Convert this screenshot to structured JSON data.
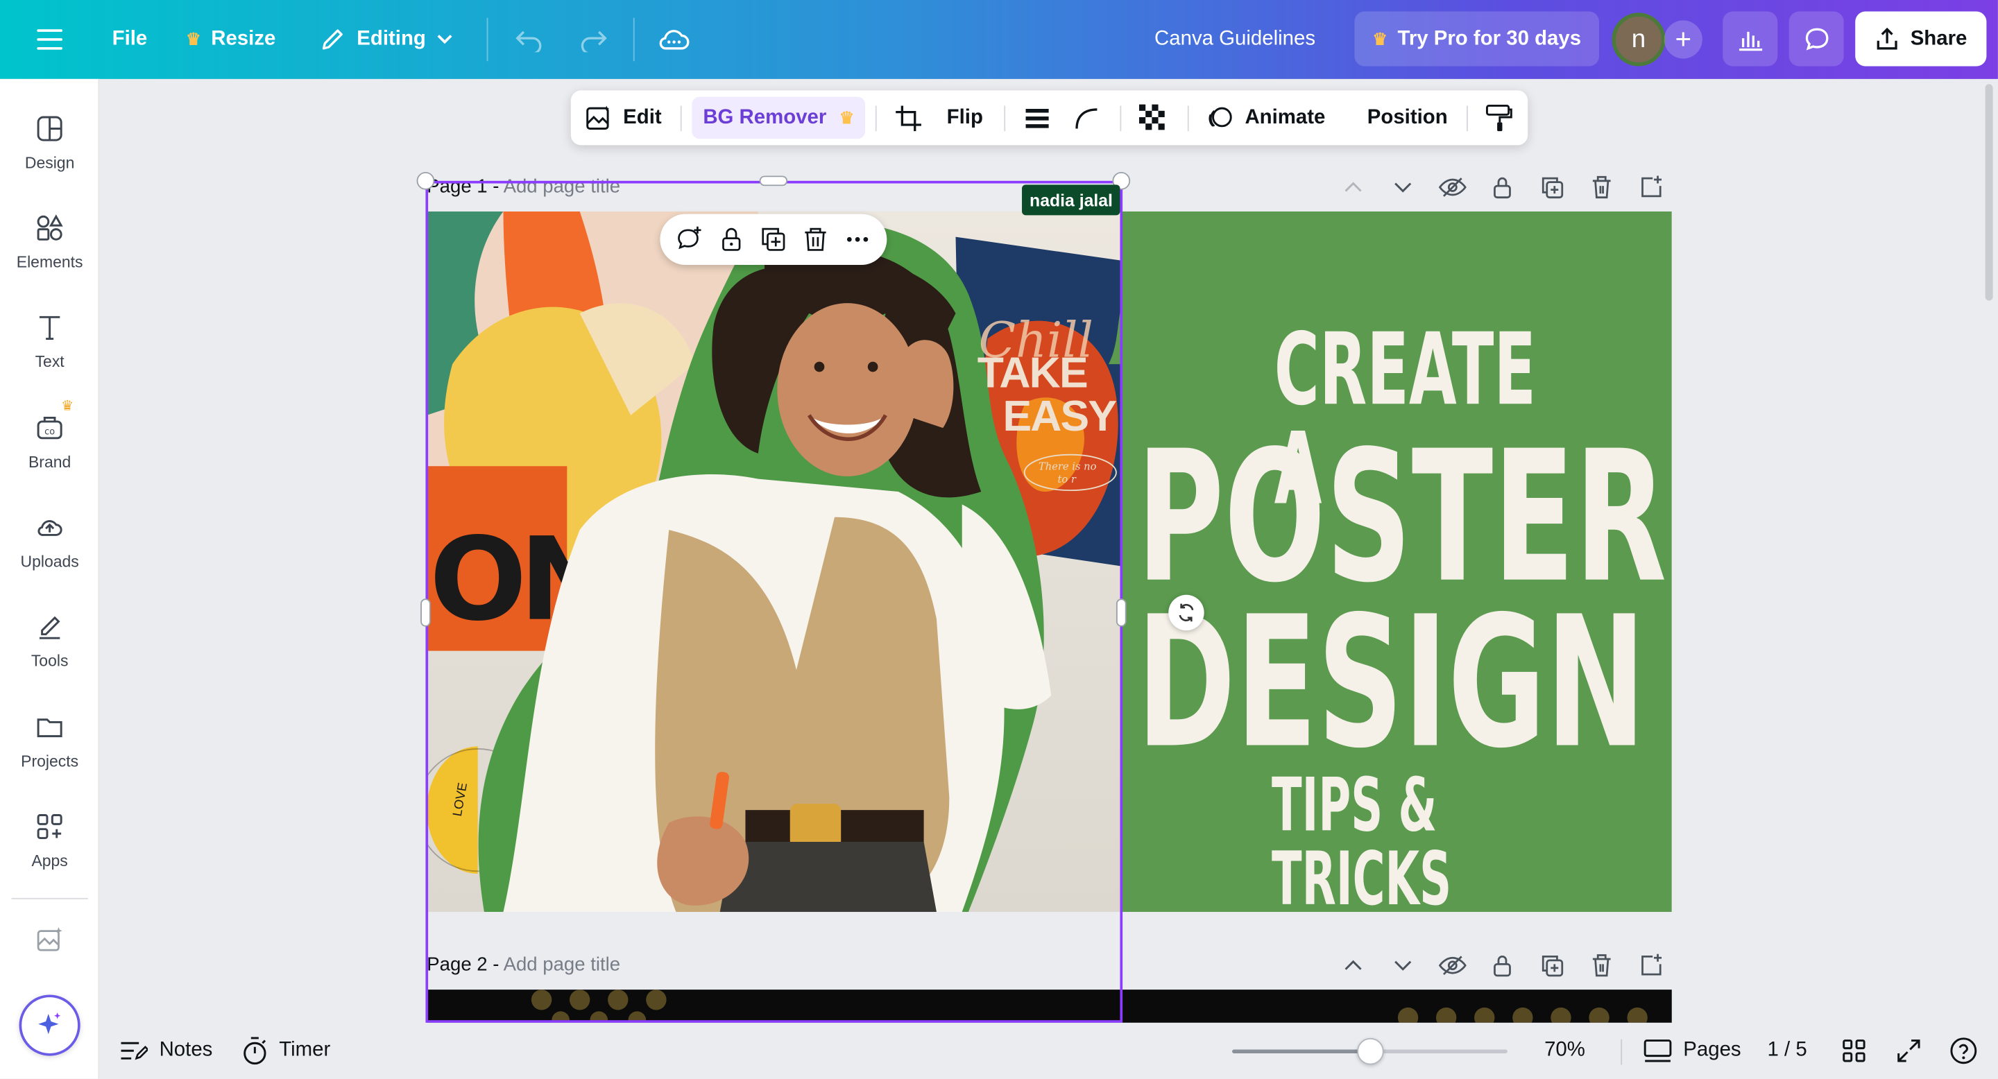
{
  "topbar": {
    "file": "File",
    "resize": "Resize",
    "editing": "Editing",
    "doc_title": "Canva Guidelines",
    "try_pro": "Try Pro for 30 days",
    "avatar_letter": "n",
    "share": "Share"
  },
  "sidebar": {
    "items": [
      {
        "label": "Design",
        "icon": "design-icon"
      },
      {
        "label": "Elements",
        "icon": "elements-icon"
      },
      {
        "label": "Text",
        "icon": "text-icon"
      },
      {
        "label": "Brand",
        "icon": "brand-icon"
      },
      {
        "label": "Uploads",
        "icon": "uploads-icon"
      },
      {
        "label": "Tools",
        "icon": "tools-icon"
      },
      {
        "label": "Projects",
        "icon": "projects-icon"
      },
      {
        "label": "Apps",
        "icon": "apps-icon"
      }
    ]
  },
  "context_toolbar": {
    "edit": "Edit",
    "bg_remover": "BG Remover",
    "flip": "Flip",
    "animate": "Animate",
    "position": "Position"
  },
  "pages": [
    {
      "prefix": "Page 1 - ",
      "placeholder": "Add page title"
    },
    {
      "prefix": "Page 2 - ",
      "placeholder": "Add page title"
    }
  ],
  "collaborator_tag": "nadia jalal",
  "poster": {
    "line1": "CREATE A",
    "line2": "POSTER",
    "line3": "DESIGN",
    "line4": "TIPS & TRICKS",
    "bg_poster_line1": "Chill",
    "bg_poster_line2": "TAKE",
    "bg_poster_line3": "EASY",
    "bg_poster_small": "There is no",
    "bg_poster_small2": "to r",
    "bg_left_text": "ONS",
    "badge_text": "LOVE"
  },
  "bottombar": {
    "notes": "Notes",
    "timer": "Timer",
    "zoom": "70%",
    "zoom_fraction": 0.5,
    "pages": "Pages",
    "page_count": "1 / 5"
  },
  "colors": {
    "accent": "#8b3dff",
    "poster_green": "#5b9a4f",
    "poster_text": "#f5f1e8",
    "crown": "#ffc14d"
  }
}
